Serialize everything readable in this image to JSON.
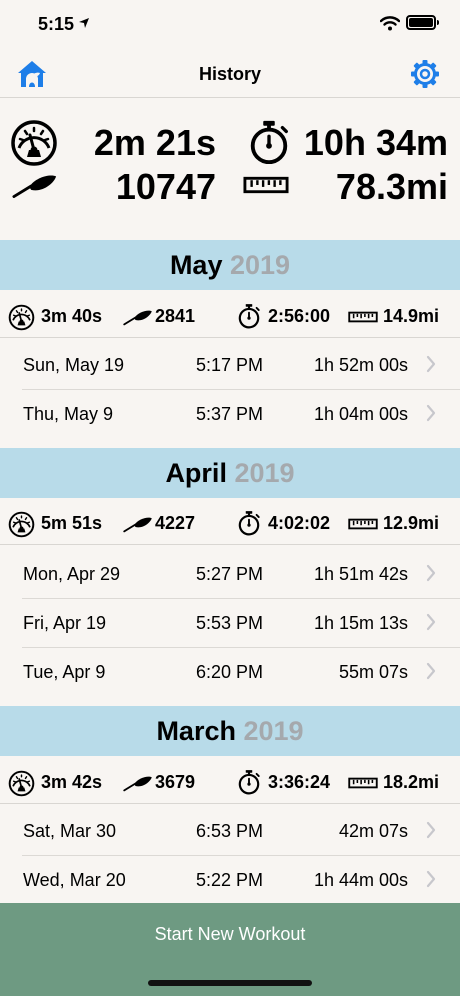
{
  "status": {
    "time": "5:15"
  },
  "nav": {
    "title": "History"
  },
  "totals": {
    "avg_pace": "2m 21s",
    "duration": "10h 34m",
    "strokes": "10747",
    "distance": "78.3mi"
  },
  "months": [
    {
      "name": "May",
      "year": "2019",
      "summary": {
        "avg_pace": "3m 40s",
        "strokes": "2841",
        "duration": "2:56:00",
        "distance": "14.9mi"
      },
      "rows": [
        {
          "date": "Sun, May 19",
          "time": "5:17 PM",
          "duration": "1h 52m 00s"
        },
        {
          "date": "Thu, May 9",
          "time": "5:37 PM",
          "duration": "1h 04m 00s"
        }
      ]
    },
    {
      "name": "April",
      "year": "2019",
      "summary": {
        "avg_pace": "5m 51s",
        "strokes": "4227",
        "duration": "4:02:02",
        "distance": "12.9mi"
      },
      "rows": [
        {
          "date": "Mon, Apr 29",
          "time": "5:27 PM",
          "duration": "1h 51m 42s"
        },
        {
          "date": "Fri, Apr 19",
          "time": "5:53 PM",
          "duration": "1h 15m 13s"
        },
        {
          "date": "Tue, Apr 9",
          "time": "6:20 PM",
          "duration": "55m 07s"
        }
      ]
    },
    {
      "name": "March",
      "year": "2019",
      "summary": {
        "avg_pace": "3m 42s",
        "strokes": "3679",
        "duration": "3:36:24",
        "distance": "18.2mi"
      },
      "rows": [
        {
          "date": "Sat, Mar 30",
          "time": "6:53 PM",
          "duration": "42m 07s"
        },
        {
          "date": "Wed, Mar 20",
          "time": "5:22 PM",
          "duration": "1h 44m 00s"
        }
      ]
    }
  ],
  "footer": {
    "start_label": "Start New Workout"
  },
  "icons": {
    "home": "home-icon",
    "settings": "gear-icon",
    "pace": "speedometer-icon",
    "strokes": "paddle-icon",
    "duration": "stopwatch-icon",
    "distance": "ruler-icon",
    "chevron": "chevron-right-icon"
  },
  "colors": {
    "accent": "#1e7ee8",
    "month_band": "#b8dbe9",
    "start_button": "#6e9a82",
    "background": "#f8f5f2"
  }
}
